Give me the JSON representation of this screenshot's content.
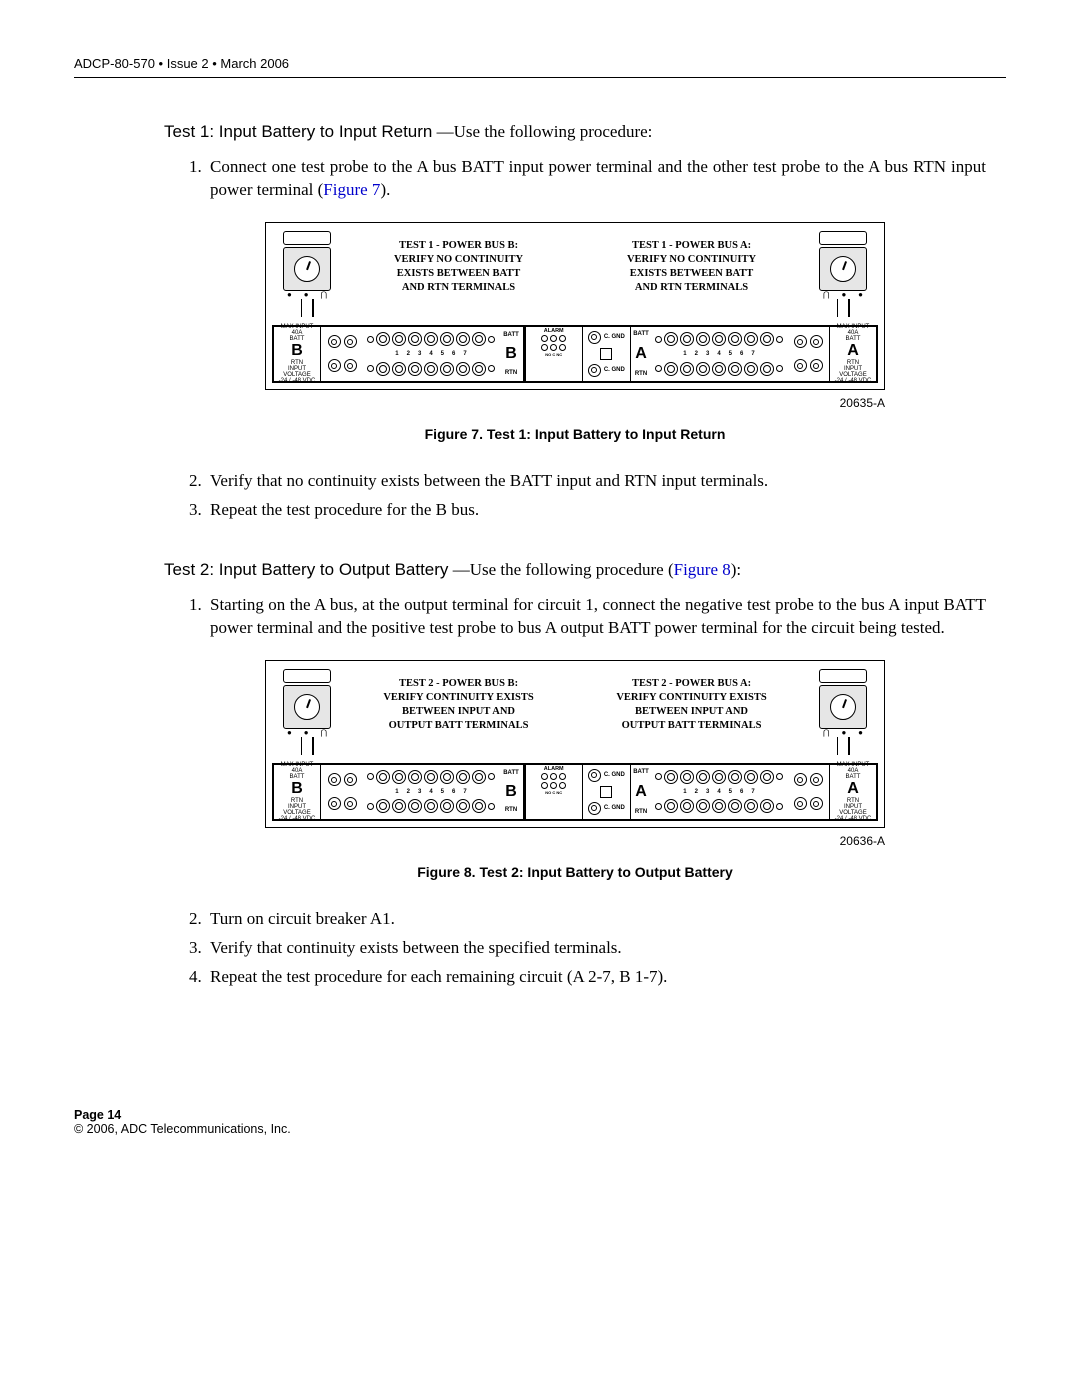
{
  "header": "ADCP-80-570 • Issue 2 • March 2006",
  "test1": {
    "title": "Test 1: Input Battery to Input Return",
    "dash": "—",
    "desc": "Use the following procedure:",
    "steps": {
      "s1a": "Connect one test probe to the A bus BATT input power terminal and the other test probe to the A bus RTN input power terminal (",
      "s1link": "Figure 7",
      "s1b": ").",
      "s2": "Verify that no continuity exists between the BATT input and RTN input terminals.",
      "s3": "Repeat the test procedure for the B bus."
    }
  },
  "fig7": {
    "labelB": "TEST 1 - POWER BUS B:\nVERIFY NO CONTINUITY\nEXISTS BETWEEN BATT\nAND RTN TERMINALS",
    "labelA": "TEST 1 - POWER BUS A:\nVERIFY NO CONTINUITY\nEXISTS BETWEEN BATT\nAND RTN TERMINALS",
    "id": "20635-A",
    "caption": "Figure 7. Test 1: Input Battery to Input Return"
  },
  "test2": {
    "title": "Test 2: Input Battery to Output Battery",
    "dash": "—",
    "desc_a": "Use the following procedure (",
    "desc_link": "Figure 8",
    "desc_b": "):",
    "steps": {
      "s1": "Starting on the A bus, at the output terminal for circuit 1, connect the negative test probe to the bus A input BATT power terminal and the positive test probe to bus A output BATT power terminal for the circuit being tested.",
      "s2": "Turn on circuit breaker A1.",
      "s3": "Verify that continuity exists between the specified terminals.",
      "s4": "Repeat the test procedure for each remaining circuit (A 2-7, B 1-7)."
    }
  },
  "fig8": {
    "labelB": "TEST 2 - POWER BUS B:\nVERIFY CONTINUITY EXISTS\nBETWEEN INPUT AND\nOUTPUT BATT TERMINALS",
    "labelA": "TEST 2 - POWER BUS A:\nVERIFY CONTINUITY EXISTS\nBETWEEN INPUT AND\nOUTPUT BATT TERMINALS",
    "id": "20636-A",
    "caption": "Figure 8. Test 2: Input Battery to Output Battery"
  },
  "panel": {
    "maxinput": "MAX INPUT 40A",
    "batt": "BATT",
    "rtn": "RTN",
    "inputvolt": "INPUT VOLTAGE\n-24 / -48 VDC",
    "B": "B",
    "A": "A",
    "alarm": "ALARM",
    "cgnd": "C. GND",
    "nums": [
      "1",
      "2",
      "3",
      "4",
      "5",
      "6",
      "7"
    ]
  },
  "footer": {
    "page": "Page 14",
    "copyright": "© 2006, ADC Telecommunications, Inc."
  }
}
